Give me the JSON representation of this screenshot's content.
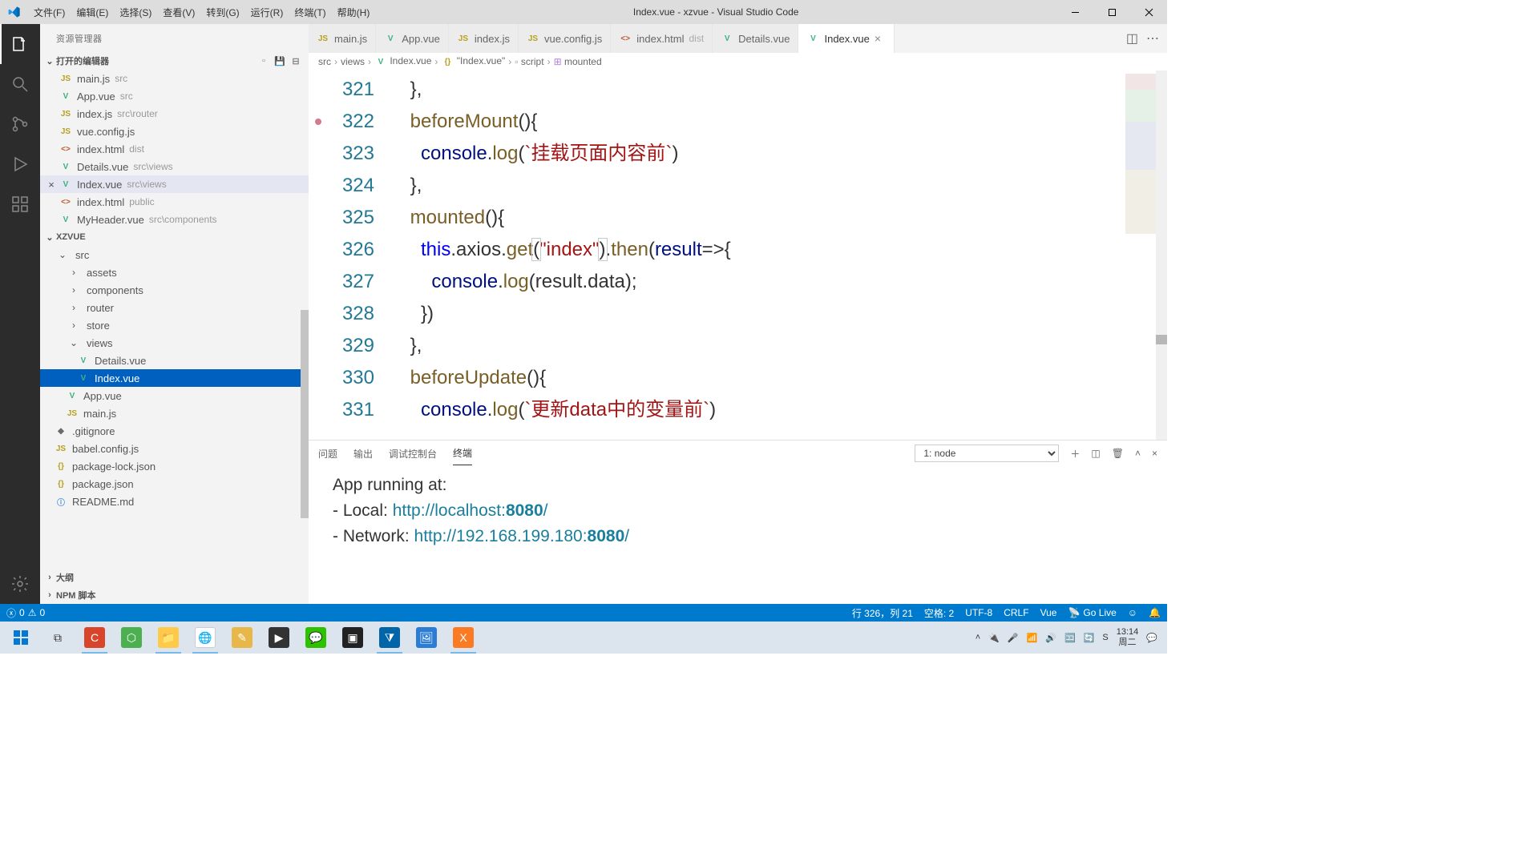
{
  "window": {
    "title": "Index.vue - xzvue - Visual Studio Code"
  },
  "menu": [
    "文件(F)",
    "编辑(E)",
    "选择(S)",
    "查看(V)",
    "转到(G)",
    "运行(R)",
    "终端(T)",
    "帮助(H)"
  ],
  "sidebar": {
    "title": "资源管理器",
    "openEditorsLabel": "打开的编辑器",
    "openEditors": [
      {
        "icon": "js",
        "name": "main.js",
        "sub": "src"
      },
      {
        "icon": "vue",
        "name": "App.vue",
        "sub": "src"
      },
      {
        "icon": "js",
        "name": "index.js",
        "sub": "src\\router"
      },
      {
        "icon": "js",
        "name": "vue.config.js",
        "sub": ""
      },
      {
        "icon": "html",
        "name": "index.html",
        "sub": "dist"
      },
      {
        "icon": "vue",
        "name": "Details.vue",
        "sub": "src\\views"
      },
      {
        "icon": "vue",
        "name": "Index.vue",
        "sub": "src\\views",
        "active": true
      },
      {
        "icon": "html",
        "name": "index.html",
        "sub": "public"
      },
      {
        "icon": "vue",
        "name": "MyHeader.vue",
        "sub": "src\\components"
      }
    ],
    "projectLabel": "XZVUE",
    "tree": [
      {
        "depth": 1,
        "chev": "down",
        "name": "src"
      },
      {
        "depth": 2,
        "chev": "right",
        "name": "assets"
      },
      {
        "depth": 2,
        "chev": "right",
        "name": "components"
      },
      {
        "depth": 2,
        "chev": "right",
        "name": "router"
      },
      {
        "depth": 2,
        "chev": "right",
        "name": "store"
      },
      {
        "depth": 2,
        "chev": "down",
        "name": "views"
      },
      {
        "depth": 3,
        "icon": "vue",
        "name": "Details.vue"
      },
      {
        "depth": 3,
        "icon": "vue",
        "name": "Index.vue",
        "selected": true
      },
      {
        "depth": 2,
        "icon": "vue",
        "name": "App.vue"
      },
      {
        "depth": 2,
        "icon": "js",
        "name": "main.js"
      },
      {
        "depth": 1,
        "icon": "git",
        "name": ".gitignore"
      },
      {
        "depth": 1,
        "icon": "js",
        "name": "babel.config.js"
      },
      {
        "depth": 1,
        "icon": "json",
        "name": "package-lock.json"
      },
      {
        "depth": 1,
        "icon": "json",
        "name": "package.json"
      },
      {
        "depth": 1,
        "icon": "md",
        "name": "README.md"
      }
    ],
    "outlineLabel": "大纲",
    "npmLabel": "NPM 脚本"
  },
  "tabs": [
    {
      "icon": "js",
      "name": "main.js"
    },
    {
      "icon": "vue",
      "name": "App.vue"
    },
    {
      "icon": "js",
      "name": "index.js"
    },
    {
      "icon": "js",
      "name": "vue.config.js"
    },
    {
      "icon": "html",
      "name": "index.html",
      "sub": "dist"
    },
    {
      "icon": "vue",
      "name": "Details.vue"
    },
    {
      "icon": "vue",
      "name": "Index.vue",
      "active": true
    }
  ],
  "breadcrumb": [
    "src",
    "views",
    "Index.vue",
    "\"Index.vue\"",
    "script",
    "mounted"
  ],
  "code": {
    "start": 321,
    "lines": [
      [
        {
          "t": "    },",
          "c": "punc"
        }
      ],
      [
        {
          "t": "    ",
          "c": "punc"
        },
        {
          "t": "beforeMount",
          "c": "fn"
        },
        {
          "t": "(){",
          "c": "punc"
        }
      ],
      [
        {
          "t": "      console",
          "c": "prop"
        },
        {
          "t": ".",
          "c": "punc"
        },
        {
          "t": "log",
          "c": "fn"
        },
        {
          "t": "(",
          "c": "punc"
        },
        {
          "t": "`",
          "c": "tmpl"
        },
        {
          "t": "挂载页面内容前",
          "c": "cn"
        },
        {
          "t": "`",
          "c": "tmpl"
        },
        {
          "t": ")",
          "c": "punc"
        }
      ],
      [
        {
          "t": "    },",
          "c": "punc"
        }
      ],
      [
        {
          "t": "    ",
          "c": "punc"
        },
        {
          "t": "mounted",
          "c": "fn"
        },
        {
          "t": "(){",
          "c": "punc"
        }
      ],
      [
        {
          "t": "      ",
          "c": "punc"
        },
        {
          "t": "this",
          "c": "this"
        },
        {
          "t": ".axios.",
          "c": "punc"
        },
        {
          "t": "get",
          "c": "fn"
        },
        {
          "t": "(",
          "c": "punc",
          "hl": 1
        },
        {
          "t": "\"index\"",
          "c": "str"
        },
        {
          "t": ")",
          "c": "punc",
          "hl": 1
        },
        {
          "t": ".",
          "c": "punc"
        },
        {
          "t": "then",
          "c": "fn"
        },
        {
          "t": "(",
          "c": "punc"
        },
        {
          "t": "result",
          "c": "param"
        },
        {
          "t": "=>",
          "c": "op"
        },
        {
          "t": "{",
          "c": "punc"
        }
      ],
      [
        {
          "t": "        console",
          "c": "prop"
        },
        {
          "t": ".",
          "c": "punc"
        },
        {
          "t": "log",
          "c": "fn"
        },
        {
          "t": "(result.data);",
          "c": "punc"
        }
      ],
      [
        {
          "t": "      })",
          "c": "punc"
        }
      ],
      [
        {
          "t": "    },",
          "c": "punc"
        }
      ],
      [
        {
          "t": "    ",
          "c": "punc"
        },
        {
          "t": "beforeUpdate",
          "c": "fn"
        },
        {
          "t": "(){",
          "c": "punc"
        }
      ],
      [
        {
          "t": "      console",
          "c": "prop"
        },
        {
          "t": ".",
          "c": "punc"
        },
        {
          "t": "log",
          "c": "fn"
        },
        {
          "t": "(",
          "c": "punc"
        },
        {
          "t": "`",
          "c": "tmpl"
        },
        {
          "t": "更新data中的变量前",
          "c": "cn"
        },
        {
          "t": "`",
          "c": "tmpl"
        },
        {
          "t": ")",
          "c": "punc"
        }
      ]
    ]
  },
  "panel": {
    "tabs": [
      "问题",
      "输出",
      "调试控制台",
      "终端"
    ],
    "activeTab": 3,
    "shell": "1: node",
    "out": {
      "l1": "App running at:",
      "l2a": "- Local:   ",
      "l2b": "http://localhost:",
      "l2c": "8080",
      "l2d": "/",
      "l3a": "- Network: ",
      "l3b": "http://192.168.199.180:",
      "l3c": "8080",
      "l3d": "/"
    }
  },
  "status": {
    "errors": "0",
    "warnings": "0",
    "pos": "行 326，列 21",
    "spaces": "空格: 2",
    "enc": "UTF-8",
    "eol": "CRLF",
    "lang": "Vue",
    "golive": "Go Live"
  },
  "tray": {
    "time": "13:14",
    "date": "周二"
  }
}
